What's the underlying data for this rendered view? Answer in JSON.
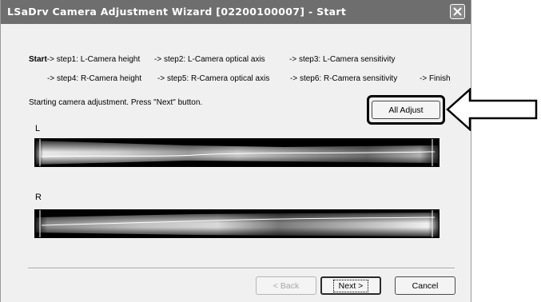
{
  "window": {
    "title": "LSaDrv Camera Adjustment Wizard [02200100007] - Start"
  },
  "steps": {
    "line1": {
      "current": "Start",
      "items": [
        "-> step1: L-Camera height",
        "-> step2: L-Camera optical axis",
        "-> step3: L-Camera sensitivity"
      ]
    },
    "line2": {
      "items": [
        "-> step4: R-Camera height",
        "-> step5: R-Camera optical axis",
        "-> step6: R-Camera sensitivity",
        "-> Finish"
      ]
    }
  },
  "status_message": "Starting camera adjustment. Press \"Next\" button.",
  "all_adjust_button": "All Adjust",
  "cameras": [
    {
      "label": "L"
    },
    {
      "label": "R"
    }
  ],
  "footer": {
    "back_label": "< Back",
    "next_label": "Next >",
    "cancel_label": "Cancel"
  },
  "icons": {
    "close": "close-icon",
    "pointer_arrow": "arrow-left-icon"
  }
}
